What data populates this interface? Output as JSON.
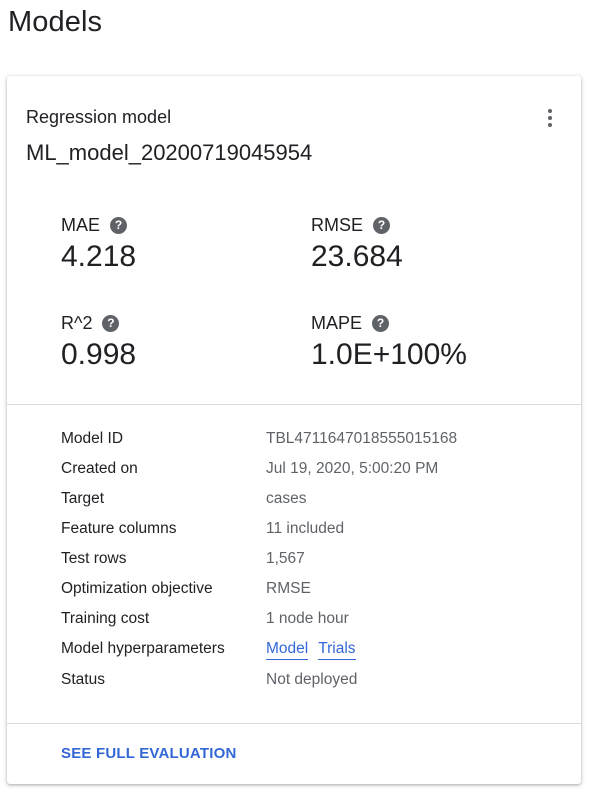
{
  "page": {
    "title": "Models"
  },
  "card": {
    "model_type": "Regression model",
    "model_name": "ML_model_20200719045954",
    "more_icon": "more-vert-icon",
    "metrics": [
      {
        "label": "MAE",
        "value": "4.218"
      },
      {
        "label": "RMSE",
        "value": "23.684"
      },
      {
        "label": "R^2",
        "value": "0.998"
      },
      {
        "label": "MAPE",
        "value": "1.0E+100%"
      }
    ],
    "help_icon_glyph": "?",
    "details": {
      "model_id": {
        "label": "Model ID",
        "value": "TBL4711647018555015168"
      },
      "created_on": {
        "label": "Created on",
        "value": "Jul 19, 2020, 5:00:20 PM"
      },
      "target": {
        "label": "Target",
        "value": "cases"
      },
      "feature_columns": {
        "label": "Feature columns",
        "value": "11 included"
      },
      "test_rows": {
        "label": "Test rows",
        "value": "1,567"
      },
      "optimization_objective": {
        "label": "Optimization objective",
        "value": "RMSE"
      },
      "training_cost": {
        "label": "Training cost",
        "value": "1 node hour"
      },
      "model_hyperparameters": {
        "label": "Model hyperparameters",
        "link_model": "Model",
        "link_trials": "Trials"
      },
      "status": {
        "label": "Status",
        "value": "Not deployed"
      }
    },
    "see_full_evaluation": "SEE FULL EVALUATION"
  },
  "colors": {
    "link": "#3367d6",
    "text_primary": "#202124",
    "text_secondary": "#5f6368",
    "divider": "#dadce0"
  }
}
